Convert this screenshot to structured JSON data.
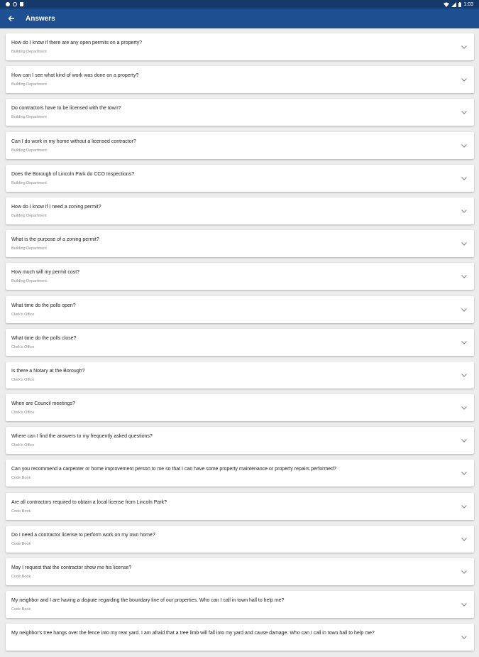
{
  "status": {
    "time": "1:03"
  },
  "header": {
    "title": "Answers"
  },
  "items": [
    {
      "q": "How do I know if there are any open permits on a property?",
      "d": "Building Department"
    },
    {
      "q": "How can I see what kind of work was done on a property?",
      "d": "Building Department"
    },
    {
      "q": "Do contractors have to be licensed with the town?",
      "d": "Building Department"
    },
    {
      "q": "Can I do work in my home without a licensed contractor?",
      "d": "Building Department"
    },
    {
      "q": "Does the Borough of Lincoln Park do CCO Inspections?",
      "d": "Building Department"
    },
    {
      "q": "How do I know if I need a zoning permit?",
      "d": "Building Department"
    },
    {
      "q": "What is the purpose of a zoning permit?",
      "d": "Building Department"
    },
    {
      "q": "How much will my permit cost?",
      "d": "Building Department"
    },
    {
      "q": "What time do the polls open?",
      "d": "Clerk's Office"
    },
    {
      "q": "What time do the polls close?",
      "d": "Clerk's Office"
    },
    {
      "q": "Is there a Notary at the Borough?",
      "d": "Clerk's Office"
    },
    {
      "q": "When are Council meetings?",
      "d": "Clerk's Office"
    },
    {
      "q": "Where can I find the answers to my frequently asked questions?",
      "d": "Clerk's Office"
    },
    {
      "q": "Can you recommend a carpenter or home improvement person to me so that I can have some property maintenance or property repairs performed?",
      "d": "Code Book"
    },
    {
      "q": "Are all contractors required to obtain a local license from Lincoln Park?",
      "d": "Code Book"
    },
    {
      "q": "Do I need a contractor license to perform work on my own home?",
      "d": "Code Book"
    },
    {
      "q": "May I request that the contractor show me his license?",
      "d": "Code Book"
    },
    {
      "q": "My neighbor and I are having a dispute regarding the boundary line of our properties. Who can I call in town hall to help me?",
      "d": "Code Book"
    },
    {
      "q": "My neighbor's tree hangs over the fence into my rear yard. I am afraid that a tree limb will fall into my yard and cause damage. Who can I call in town hall to help me?",
      "d": ""
    }
  ]
}
